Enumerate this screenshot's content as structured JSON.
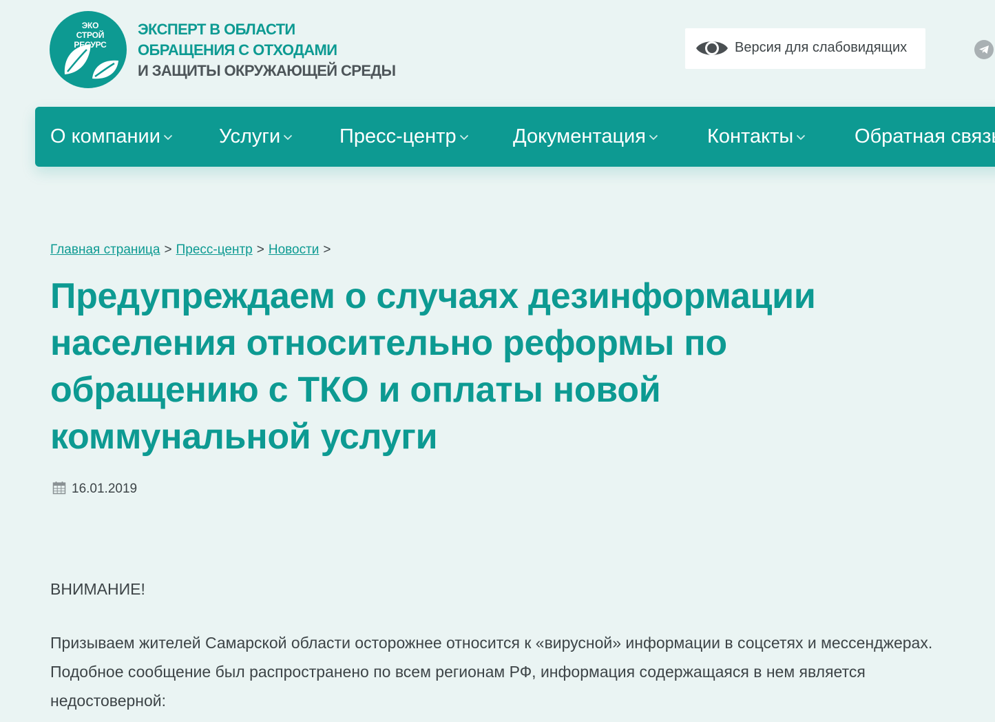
{
  "logo": {
    "lines": [
      "ЭКО",
      "СТРОЙ",
      "РЕСУРС"
    ]
  },
  "tagline": {
    "line1": "ЭКСПЕРТ В ОБЛАСТИ",
    "line2": "ОБРАЩЕНИЯ С ОТХОДАМИ",
    "line3": "И ЗАЩИТЫ ОКРУЖАЮЩЕЙ СРЕДЫ"
  },
  "header": {
    "vision_label": "Версия для слабовидящих"
  },
  "nav": {
    "items": [
      {
        "label": "О компании"
      },
      {
        "label": "Услуги"
      },
      {
        "label": "Пресс-центр"
      },
      {
        "label": "Документация"
      },
      {
        "label": "Контакты"
      },
      {
        "label": "Обратная связь"
      }
    ]
  },
  "breadcrumb": {
    "items": [
      "Главная страница",
      "Пресс-центр",
      "Новости"
    ],
    "separator": ">"
  },
  "article": {
    "title": "Предупреждаем о случаях дезинформации населения относительно реформы по обращению с ТКО и оплаты новой коммунальной услуги",
    "date": "16.01.2019",
    "attention": "ВНИМАНИЕ!",
    "paragraph": "Призываем жителей Самарской области осторожнее относится к «вирусной» информации в соцсетях и мессенджерах. Подобное сообщение был распространено по всем регионам РФ, информация содержащаяся в нем является недостоверной:"
  },
  "colors": {
    "accent": "#0d9a92",
    "background": "#eaf4f3",
    "text": "#3d4447"
  },
  "icons": [
    "eye-icon",
    "telegram-icon",
    "chevron-down-icon",
    "calendar-icon",
    "leaf-icon"
  ]
}
